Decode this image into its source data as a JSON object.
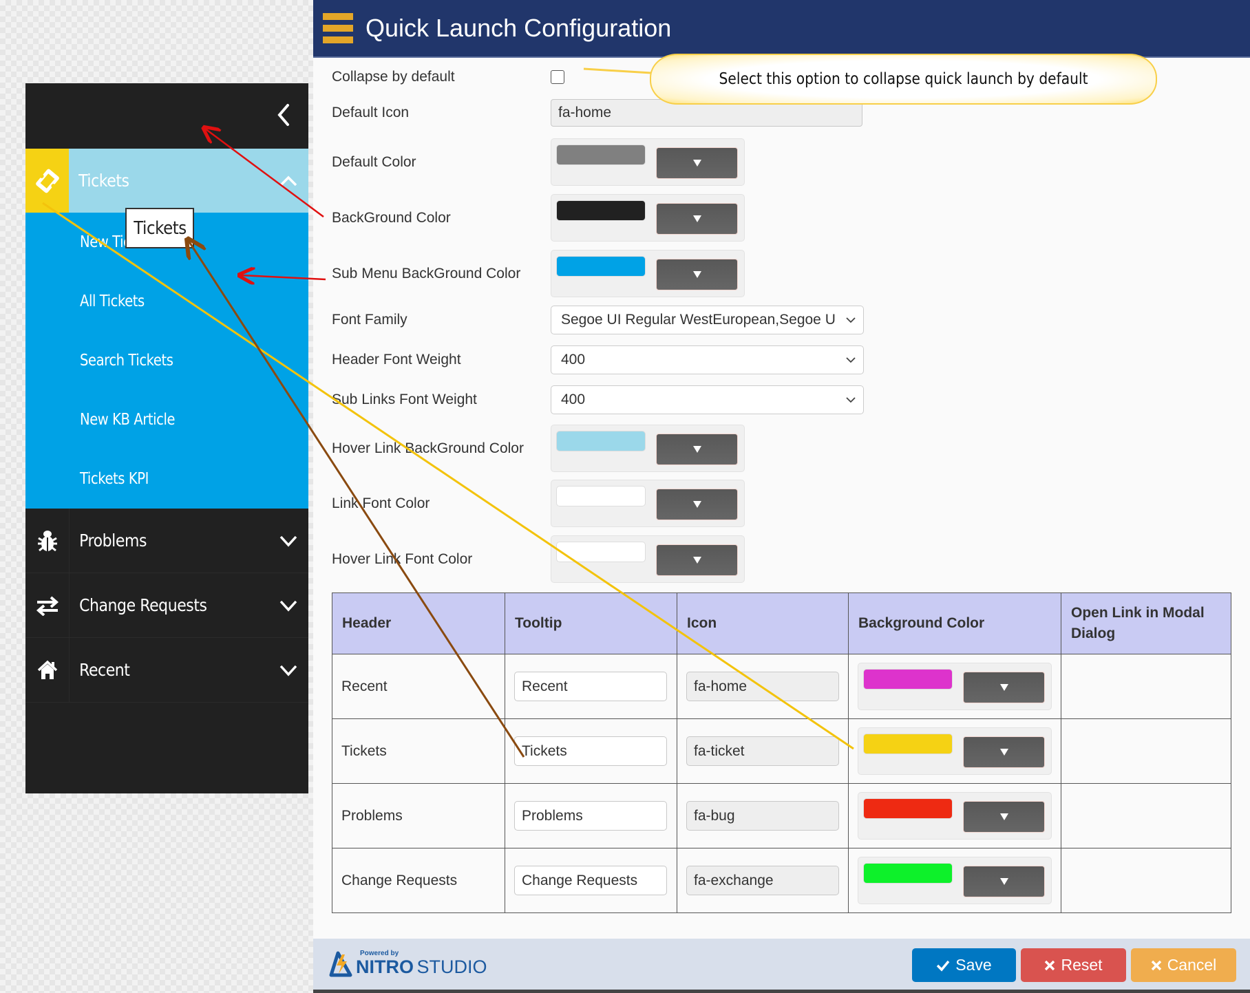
{
  "preview": {
    "tooltip": "Tickets",
    "menu": [
      {
        "label": "Tickets",
        "icon": "ticket-icon",
        "expanded": true,
        "sublinks": [
          "New Tickets",
          "All Tickets",
          "Search Tickets",
          "New KB Article",
          "Tickets KPI"
        ]
      },
      {
        "label": "Problems",
        "icon": "bug-icon",
        "expanded": false
      },
      {
        "label": "Change Requests",
        "icon": "exchange-icon",
        "expanded": false
      },
      {
        "label": "Recent",
        "icon": "home-icon",
        "expanded": false
      }
    ],
    "colors": {
      "background": "#212121",
      "submenu": "#00a2e6",
      "hover": "#9bd8ea",
      "tickets_icon_bg": "#f5d214"
    }
  },
  "header": {
    "title": "Quick Launch Configuration"
  },
  "callout": {
    "text": "Select this option to collapse quick launch by default"
  },
  "form": {
    "collapse_label": "Collapse by default",
    "collapse_checked": false,
    "default_icon_label": "Default Icon",
    "default_icon_value": "fa-home",
    "default_color_label": "Default Color",
    "default_color": "#808080",
    "background_color_label": "BackGround Color",
    "background_color": "#212121",
    "submenu_bg_label": "Sub Menu BackGround Color",
    "submenu_bg_color": "#00a2e6",
    "font_family_label": "Font Family",
    "font_family_value": "Segoe UI Regular WestEuropean,Segoe UI",
    "header_weight_label": "Header Font Weight",
    "header_weight_value": "400",
    "sublinks_weight_label": "Sub Links Font Weight",
    "sublinks_weight_value": "400",
    "hover_bg_label": "Hover Link BackGround Color",
    "hover_bg_color": "#9bd8ea",
    "link_font_label": "Link Font Color",
    "link_font_color": "#ffffff",
    "hover_font_label": "Hover Link Font Color",
    "hover_font_color": "#ffffff"
  },
  "table": {
    "columns": [
      "Header",
      "Tooltip",
      "Icon",
      "Background Color",
      "Open Link in Modal Dialog"
    ],
    "rows": [
      {
        "header": "Recent",
        "tooltip": "Recent",
        "icon": "fa-home",
        "color": "#dd33cc"
      },
      {
        "header": "Tickets",
        "tooltip": "Tickets",
        "icon": "fa-ticket",
        "color": "#f5d214"
      },
      {
        "header": "Problems",
        "tooltip": "Problems",
        "icon": "fa-bug",
        "color": "#ee2a12"
      },
      {
        "header": "Change Requests",
        "tooltip": "Change Requests",
        "icon": "fa-exchange",
        "color": "#0df12a"
      }
    ]
  },
  "footer": {
    "powered_by": "Powered by",
    "brand_bold": "NITRO",
    "brand_light": "STUDIO",
    "save_label": "Save",
    "reset_label": "Reset",
    "cancel_label": "Cancel",
    "save_color": "#0077c2",
    "reset_color": "#d9534f",
    "cancel_color": "#f0ad4e"
  }
}
